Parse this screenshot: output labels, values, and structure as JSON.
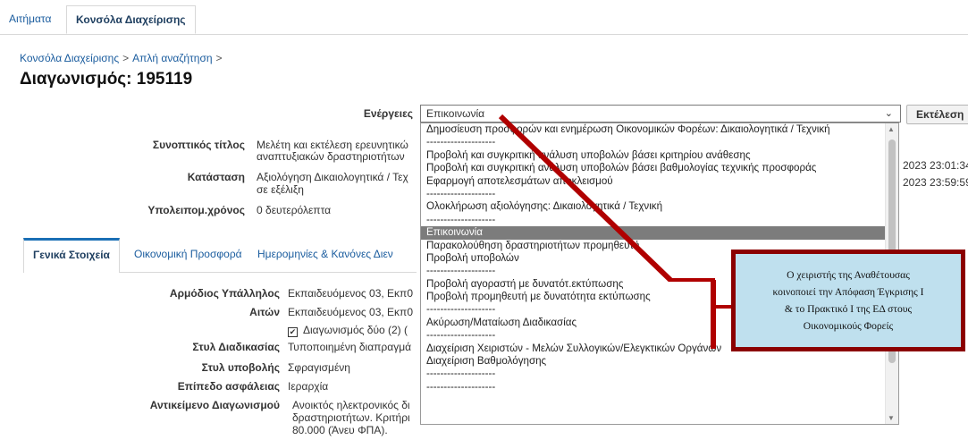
{
  "top_tabs": [
    "Αιτήματα",
    "Κονσόλα Διαχείρισης"
  ],
  "breadcrumb": {
    "item1": "Κονσόλα Διαχείρισης",
    "sep": ">",
    "item2": "Απλή αναζήτηση",
    "trail": ">"
  },
  "page_title": "Διαγωνισμός: 195119",
  "actions": {
    "label": "Ενέργειες",
    "selected": "Επικοινωνία",
    "run_button": "Εκτέλεση"
  },
  "summary": {
    "title_label": "Συνοπτικός τίτλος",
    "title_value_line1": "Μελέτη και εκτέλεση ερευνητικώ",
    "title_value_line2": "αναπτυξιακών δραστηριοτήτων",
    "status_label": "Κατάσταση",
    "status_value_line1": "Αξιολόγηση Δικαιολογητικά / Τεχ",
    "status_value_line2": "σε εξέλιξη",
    "remaining_label": "Υπολειπομ.χρόνος",
    "remaining_value": "0 δευτερόλεπτα",
    "date1": "2023 23:01:34",
    "date2": "2023 23:59:59"
  },
  "dropdown_options": [
    "Δημοσίευση προσφορών και ενημέρωση Οικονομικών Φορέων: Δικαιολογητικά / Τεχνική",
    "--------------------",
    "Προβολή και συγκριτική ανάλυση υποβολών βάσει κριτηρίου ανάθεσης",
    "Προβολή και συγκριτική ανάλυση υποβολών βάσει βαθμολογίας τεχνικής προσφοράς",
    "Εφαρμογή αποτελεσμάτων αποκλεισμού",
    "--------------------",
    "Ολοκλήρωση αξιολόγησης: Δικαιολογητικά / Τεχνική",
    "--------------------",
    "Επικοινωνία",
    "Παρακολούθηση δραστηριοτήτων προμηθευτή",
    "Προβολή υποβολών",
    "--------------------",
    "Προβολή αγοραστή με δυνατότ.εκτύπωσης",
    "Προβολή προμηθευτή με δυνατότητα εκτύπωσης",
    "--------------------",
    "Ακύρωση/Ματαίωση Διαδικασίας",
    "--------------------",
    "Διαχείριση Χειριστών - Μελών Συλλογικών/Ελεγκτικών Οργάνων",
    "Διαχείριση Βαθμολόγησης",
    "--------------------",
    "--------------------"
  ],
  "selected_option_index": 8,
  "section_tabs": [
    "Γενικά Στοιχεία",
    "Οικονομική Προσφορά",
    "Ημερομηνίες & Κανόνες Διεν"
  ],
  "general": {
    "officer_label": "Αρμόδιος Υπάλληλος",
    "officer_value": "Εκπαιδευόμενος 03, Εκπ0",
    "requester_label": "Αιτών",
    "requester_value": "Εκπαιδευόμενος 03, Εκπ0",
    "stages_value": "Διαγωνισμός δύο (2) (",
    "stages_checked": true,
    "procedure_label": "Στυλ Διαδικασίας",
    "procedure_value": "Τυποποιημένη διαπραγμά",
    "submission_label": "Στυλ υποβολής",
    "submission_value": "Σφραγισμένη",
    "security_label": "Επίπεδο ασφάλειας",
    "security_value": "Ιεραρχία",
    "object_label": "Αντικείμενο Διαγωνισμού",
    "object_line1": "Ανοικτός ηλεκτρονικός δι",
    "object_line2": "δραστηριοτήτων. Κριτήρι",
    "object_line3": "80.000 (Άνευ ΦΠΑ)."
  },
  "callout": {
    "line1": "Ο χειριστής της Αναθέτουσας",
    "line2": "κοινοποιεί την Απόφαση Έγκρισης Ι",
    "line3": "& το Πρακτικό Ι της ΕΔ στους",
    "line4": "Οικονομικούς Φορείς"
  },
  "colors": {
    "link": "#1a5c9e",
    "annotation_line": "#b00000",
    "callout_bg": "#bfe0ee"
  },
  "icons": {
    "select_arrow": "chevron-down-icon",
    "checkbox": "checkbox-checked-icon"
  }
}
